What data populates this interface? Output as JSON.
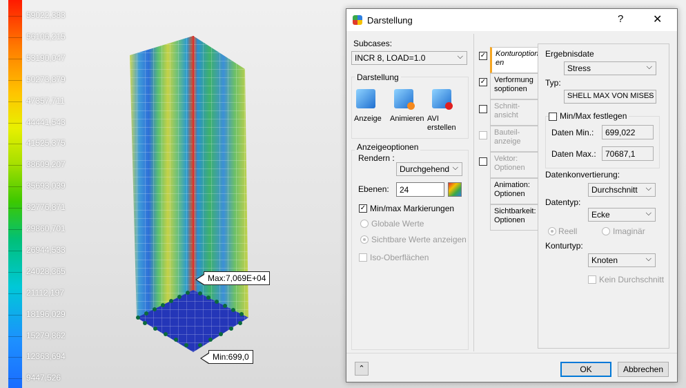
{
  "legend": {
    "values": [
      "59022,383",
      "56106,215",
      "53190,047",
      "50273,879",
      "47357,711",
      "44441,543",
      "41525,375",
      "38609,207",
      "35693,039",
      "32776,871",
      "29860,701",
      "26944,533",
      "24028,365",
      "21112,197",
      "18196,029",
      "15279,862",
      "12363,694",
      "9447,526"
    ]
  },
  "viewport": {
    "max_label": "Max:7,069E+04",
    "min_label": "Min:699,0"
  },
  "dialog": {
    "title": "Darstellung",
    "help_label": "?",
    "close_label": "✕",
    "subcases_label": "Subcases:",
    "subcase_value": "INCR 8, LOAD=1.0",
    "darstellung_group": "Darstellung",
    "tools": [
      {
        "label": "Anzeige",
        "icon": "display-icon"
      },
      {
        "label": "Animieren",
        "icon": "animate-icon"
      },
      {
        "label": "AVI\nerstellen",
        "icon": "avi-record-icon"
      }
    ],
    "anzeige_group": "Anzeigeoptionen",
    "rendern_label": "Rendern :",
    "rendern_value": "Durchgehend",
    "ebenen_label": "Ebenen:",
    "ebenen_value": "24",
    "minmax_label": "Min/max Markierungen",
    "globale_label": "Globale Werte",
    "sichtbare_label": "Sichtbare Werte anzeigen",
    "iso_label": "Iso-Oberflächen",
    "tabs": [
      {
        "label": "Konturoption\nen",
        "checked": true,
        "enabled": true
      },
      {
        "label": "Verformung\nsoptionen",
        "checked": true,
        "enabled": true
      },
      {
        "label": "Schnitt-\nansicht",
        "checked": false,
        "enabled": false
      },
      {
        "label": "Bauteil-\nanzeige",
        "checked": false,
        "enabled": false
      },
      {
        "label": "Vektor:\nOptionen",
        "checked": false,
        "enabled": false
      },
      {
        "label": "Animation:\nOptionen",
        "checked": null,
        "enabled": true
      },
      {
        "label": "Sichtbarkeit:\nOptionen",
        "checked": null,
        "enabled": true
      }
    ],
    "ergebnis_label": "Ergebnisdate",
    "ergebnis_value": "Stress",
    "typ_label": "Typ:",
    "typ_value": "SHELL MAX VON MISES",
    "fest_label": "Min/Max festlegen",
    "daten_min_label": "Daten Min.:",
    "daten_min_value": "699,022",
    "daten_max_label": "Daten Max.:",
    "daten_max_value": "70687,1",
    "datenkonv_label": "Datenkonvertierung:",
    "datenkonv_value": "Durchschnitt",
    "datentyp_label": "Datentyp:",
    "datentyp_value": "Ecke",
    "reell_label": "Reell",
    "imag_label": "Imaginär",
    "kontur_label": "Konturtyp:",
    "kontur_value": "Knoten",
    "kein_label": "Kein Durchschnitt",
    "ok_label": "OK",
    "cancel_label": "Abbrechen",
    "collapse_icon": "double-chevron-up-icon"
  }
}
